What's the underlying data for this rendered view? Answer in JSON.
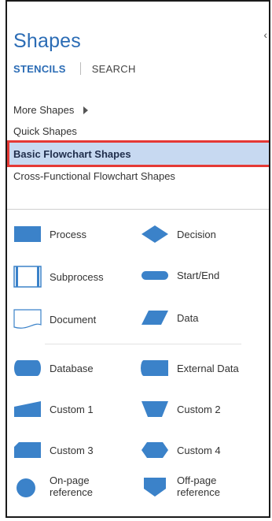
{
  "pane": {
    "title": "Shapes",
    "tabs": {
      "stencils": "STENCILS",
      "search": "SEARCH"
    }
  },
  "menu": {
    "more_shapes": "More Shapes",
    "quick_shapes": "Quick Shapes",
    "basic_flowchart": "Basic Flowchart Shapes",
    "cross_functional": "Cross-Functional Flowchart Shapes"
  },
  "shapes": {
    "process": "Process",
    "decision": "Decision",
    "subprocess": "Subprocess",
    "start_end": "Start/End",
    "document": "Document",
    "data": "Data",
    "database": "Database",
    "external_data": "External Data",
    "custom1": "Custom 1",
    "custom2": "Custom 2",
    "custom3": "Custom 3",
    "custom4": "Custom 4",
    "onpage_line1": "On-page",
    "onpage_line2": "reference",
    "offpage_line1": "Off-page",
    "offpage_line2": "reference"
  },
  "colors": {
    "accent": "#2b6cb5",
    "shape_fill": "#3b82c9",
    "selection_bg": "#c7d9f1",
    "selection_border": "#e53935"
  }
}
